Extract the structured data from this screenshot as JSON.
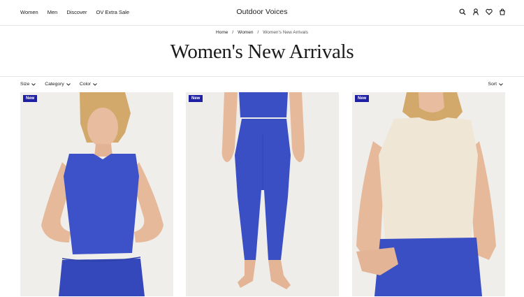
{
  "nav": {
    "items": [
      "Women",
      "Men",
      "Discover",
      "OV Extra Sale"
    ],
    "brand": "Outdoor Voices",
    "icons": [
      "search-icon",
      "account-icon",
      "wishlist-icon",
      "bag-icon"
    ]
  },
  "breadcrumb": {
    "home": "Home",
    "sep": "/",
    "women": "Women",
    "current": "Women's New Arrivals"
  },
  "page": {
    "title": "Women's New Arrivals"
  },
  "filters": {
    "size": "Size",
    "category": "Category",
    "color": "Color",
    "sort": "Sort"
  },
  "products": [
    {
      "badge": "New"
    },
    {
      "badge": "New"
    },
    {
      "badge": "New"
    }
  ],
  "colors": {
    "badge": "#1f1fa3",
    "fabric_blue": "#3a4fc4",
    "cream_top": "#efe6d6",
    "skin": "#e6b99b",
    "photo_bg": "#ecebe8"
  }
}
